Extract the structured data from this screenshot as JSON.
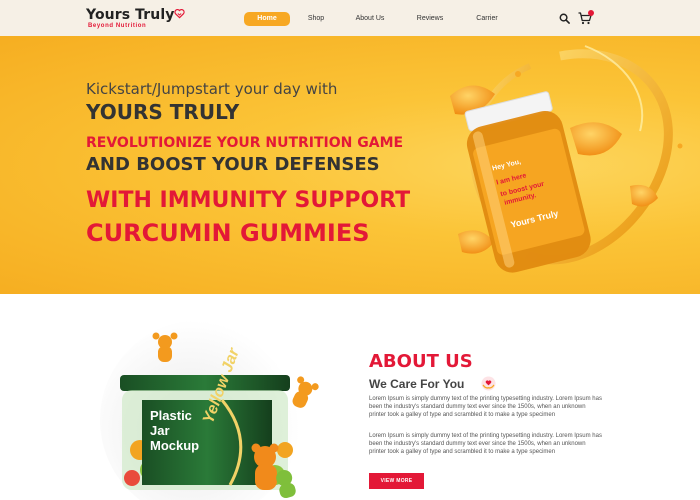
{
  "brand": {
    "name": "Yours Truly",
    "tagline": "Beyond Nutrition"
  },
  "nav": {
    "items": [
      {
        "label": "Home",
        "active": true
      },
      {
        "label": "Shop",
        "active": false
      },
      {
        "label": "About Us",
        "active": false
      },
      {
        "label": "Reviews",
        "active": false
      },
      {
        "label": "Carrier",
        "active": false
      }
    ]
  },
  "header_icons": [
    "search-icon",
    "cart-icon"
  ],
  "hero": {
    "line1": "Kickstart/Jumpstart your day with",
    "line2": "YOURS TRULY",
    "line3": "REVOLUTIONIZE YOUR NUTRITION GAME",
    "line4": "AND BOOST YOUR DEFENSES",
    "line5": "WITH IMMUNITY SUPPORT",
    "line6": "CURCUMIN GUMMIES",
    "product_label": {
      "line1": "Hey You,",
      "line2": "I am here",
      "line3": "to boost your",
      "line4": "immunity.",
      "brand": "Yours Truly"
    }
  },
  "about": {
    "title": "ABOUT US",
    "subtitle": "We Care For You",
    "paragraph1": "Lorem Ipsum is simply dummy text of the printing typesetting industry. Lorem Ipsum has been the industry's standard dummy text ever since the 1500s, when an unknown printer took a galley of type and scrambled it to make a type specimen",
    "paragraph2": "Lorem Ipsum is simply dummy text of the printing typesetting industry. Lorem Ipsum has been the industry's standard dummy text ever since the 1500s, when an unknown printer took a galley of type and scrambled it to make a type specimen",
    "button_label": "VIEW MORE",
    "mockup_label": {
      "line1": "Plastic",
      "line2": "Jar",
      "line3": "Mockup",
      "script": "Yellow Jar"
    }
  },
  "colors": {
    "accent_red": "#e31837",
    "accent_orange": "#f7a823",
    "hero_yellow": "#fbc437",
    "header_bg": "#f6f0e6",
    "jar_green": "#1f5e2c"
  }
}
